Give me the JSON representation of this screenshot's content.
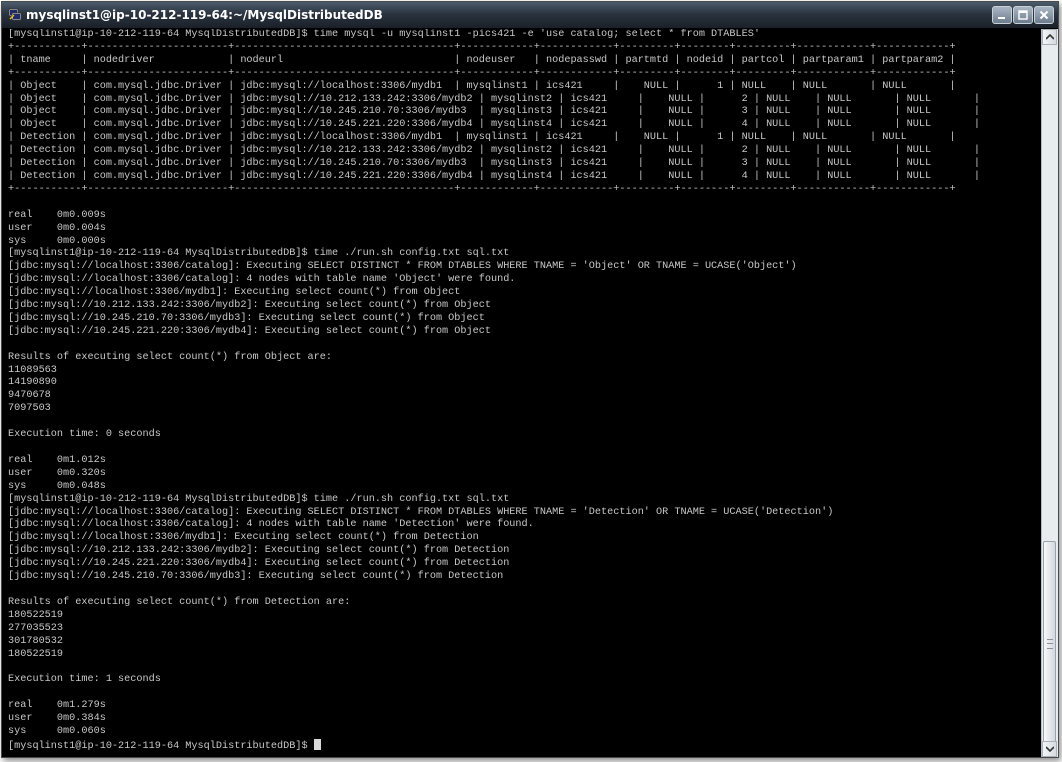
{
  "window": {
    "title": "mysqlinst1@ip-10-212-119-64:~/MysqlDistributedDB",
    "icon": "putty-terminal-icon",
    "titlebar_color": "#2a3440",
    "background": "#000000",
    "text_color": "#c8c8c8"
  },
  "terminal": {
    "lines": [
      "[mysqlinst1@ip-10-212-119-64 MysqlDistributedDB]$ time mysql -u mysqlinst1 -pics421 -e 'use catalog; select * from DTABLES'",
      "+-----------+-----------------------+------------------------------------+------------+------------+---------+--------+---------+------------+------------+",
      "| tname     | nodedriver            | nodeurl                            | nodeuser   | nodepasswd | partmtd | nodeid | partcol | partparam1 | partparam2 |",
      "+-----------+-----------------------+------------------------------------+------------+------------+---------+--------+---------+------------+------------+",
      "| Object    | com.mysql.jdbc.Driver | jdbc:mysql://localhost:3306/mydb1  | mysqlinst1 | ics421     |    NULL |      1 | NULL    | NULL       | NULL       |",
      "| Object    | com.mysql.jdbc.Driver | jdbc:mysql://10.212.133.242:3306/mydb2 | mysqlinst2 | ics421     |    NULL |      2 | NULL    | NULL       | NULL       |",
      "| Object    | com.mysql.jdbc.Driver | jdbc:mysql://10.245.210.70:3306/mydb3  | mysqlinst3 | ics421     |    NULL |      3 | NULL    | NULL       | NULL       |",
      "| Object    | com.mysql.jdbc.Driver | jdbc:mysql://10.245.221.220:3306/mydb4 | mysqlinst4 | ics421     |    NULL |      4 | NULL    | NULL       | NULL       |",
      "| Detection | com.mysql.jdbc.Driver | jdbc:mysql://localhost:3306/mydb1  | mysqlinst1 | ics421     |    NULL |      1 | NULL    | NULL       | NULL       |",
      "| Detection | com.mysql.jdbc.Driver | jdbc:mysql://10.212.133.242:3306/mydb2 | mysqlinst2 | ics421     |    NULL |      2 | NULL    | NULL       | NULL       |",
      "| Detection | com.mysql.jdbc.Driver | jdbc:mysql://10.245.210.70:3306/mydb3  | mysqlinst3 | ics421     |    NULL |      3 | NULL    | NULL       | NULL       |",
      "| Detection | com.mysql.jdbc.Driver | jdbc:mysql://10.245.221.220:3306/mydb4 | mysqlinst4 | ics421     |    NULL |      4 | NULL    | NULL       | NULL       |",
      "+-----------+-----------------------+------------------------------------+------------+------------+---------+--------+---------+------------+------------+",
      "",
      "real    0m0.009s",
      "user    0m0.004s",
      "sys     0m0.000s",
      "[mysqlinst1@ip-10-212-119-64 MysqlDistributedDB]$ time ./run.sh config.txt sql.txt",
      "[jdbc:mysql://localhost:3306/catalog]: Executing SELECT DISTINCT * FROM DTABLES WHERE TNAME = 'Object' OR TNAME = UCASE('Object')",
      "[jdbc:mysql://localhost:3306/catalog]: 4 nodes with table name 'Object' were found.",
      "[jdbc:mysql://localhost:3306/mydb1]: Executing select count(*) from Object",
      "[jdbc:mysql://10.212.133.242:3306/mydb2]: Executing select count(*) from Object",
      "[jdbc:mysql://10.245.210.70:3306/mydb3]: Executing select count(*) from Object",
      "[jdbc:mysql://10.245.221.220:3306/mydb4]: Executing select count(*) from Object",
      "",
      "Results of executing select count(*) from Object are:",
      "11089563",
      "14190890",
      "9470678",
      "7097503",
      "",
      "Execution time: 0 seconds",
      "",
      "real    0m1.012s",
      "user    0m0.320s",
      "sys     0m0.048s",
      "[mysqlinst1@ip-10-212-119-64 MysqlDistributedDB]$ time ./run.sh config.txt sql.txt",
      "[jdbc:mysql://localhost:3306/catalog]: Executing SELECT DISTINCT * FROM DTABLES WHERE TNAME = 'Detection' OR TNAME = UCASE('Detection')",
      "[jdbc:mysql://localhost:3306/catalog]: 4 nodes with table name 'Detection' were found.",
      "[jdbc:mysql://localhost:3306/mydb1]: Executing select count(*) from Detection",
      "[jdbc:mysql://10.212.133.242:3306/mydb2]: Executing select count(*) from Detection",
      "[jdbc:mysql://10.245.221.220:3306/mydb4]: Executing select count(*) from Detection",
      "[jdbc:mysql://10.245.210.70:3306/mydb3]: Executing select count(*) from Detection",
      "",
      "Results of executing select count(*) from Detection are:",
      "180522519",
      "277035523",
      "301780532",
      "180522519",
      "",
      "Execution time: 1 seconds",
      "",
      "real    0m1.279s",
      "user    0m0.384s",
      "sys     0m0.060s"
    ],
    "prompt": "[mysqlinst1@ip-10-212-119-64 MysqlDistributedDB]$ "
  }
}
